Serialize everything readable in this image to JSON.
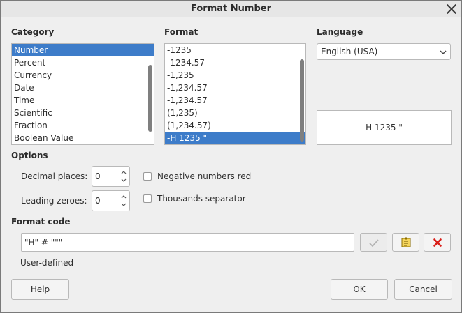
{
  "window": {
    "title": "Format Number"
  },
  "category": {
    "label": "Category",
    "items": [
      "Number",
      "Percent",
      "Currency",
      "Date",
      "Time",
      "Scientific",
      "Fraction",
      "Boolean Value"
    ],
    "selected_index": 0
  },
  "format": {
    "label": "Format",
    "items": [
      "-1235",
      "-1234.57",
      "-1,235",
      "-1,234.57",
      "-1,234.57",
      "(1,235)",
      "(1,234.57)",
      "-H 1235 \""
    ],
    "selected_index": 7
  },
  "language": {
    "label": "Language",
    "selected": "English (USA)"
  },
  "preview": {
    "text": "H 1235 \""
  },
  "options": {
    "label": "Options",
    "decimal_places_label": "Decimal places:",
    "decimal_places_value": "0",
    "leading_zeroes_label": "Leading zeroes:",
    "leading_zeroes_value": "0",
    "negative_red_label": "Negative numbers red",
    "negative_red_checked": false,
    "thousands_sep_label": "Thousands separator",
    "thousands_sep_checked": false
  },
  "format_code": {
    "label": "Format code",
    "value": "\"H\" # \"\"\"",
    "status": "User-defined"
  },
  "buttons": {
    "help": "Help",
    "ok": "OK",
    "cancel": "Cancel"
  },
  "colors": {
    "selection": "#3d7cc9",
    "delete_icon": "#d91e18",
    "note_icon": "#e8c23a"
  }
}
